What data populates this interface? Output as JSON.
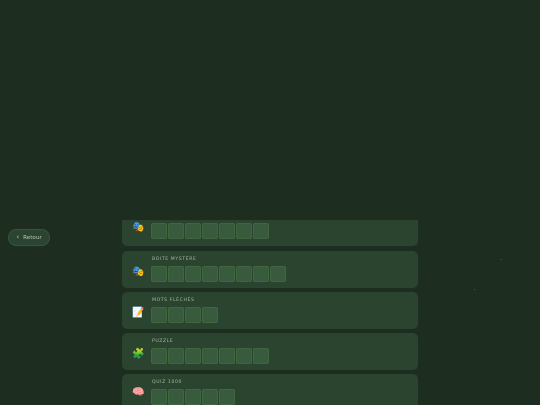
{
  "nav": {
    "back_label": "Retour",
    "back_icon": "chevron-left-icon"
  },
  "cards": [
    {
      "title": "",
      "icon": "theater-masks-icon",
      "emoji": "🎭",
      "tiles": 7
    },
    {
      "title": "BOITE MYSTÈRE",
      "icon": "theater-masks-icon",
      "emoji": "🎭",
      "tiles": 8
    },
    {
      "title": "MOTS FLÉCHÉS",
      "icon": "memo-icon",
      "emoji": "📝",
      "tiles": 4
    },
    {
      "title": "PUZZLE",
      "icon": "puzzle-piece-icon",
      "emoji": "🧩",
      "tiles": 7
    },
    {
      "title": "QUIZ 1000",
      "icon": "brain-icon",
      "emoji": "🧠",
      "tiles": 5
    }
  ]
}
